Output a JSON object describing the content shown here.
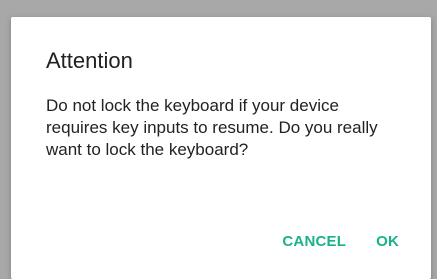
{
  "dialog": {
    "title": "Attention",
    "message": "Do not lock the keyboard if your device requires key inputs to resume. Do you really want to lock the keyboard?",
    "cancel_label": "CANCEL",
    "ok_label": "OK"
  },
  "colors": {
    "accent": "#19b28a",
    "text": "#222222",
    "dialog_bg": "#ffffff",
    "scrim": "#a8a8a8"
  }
}
